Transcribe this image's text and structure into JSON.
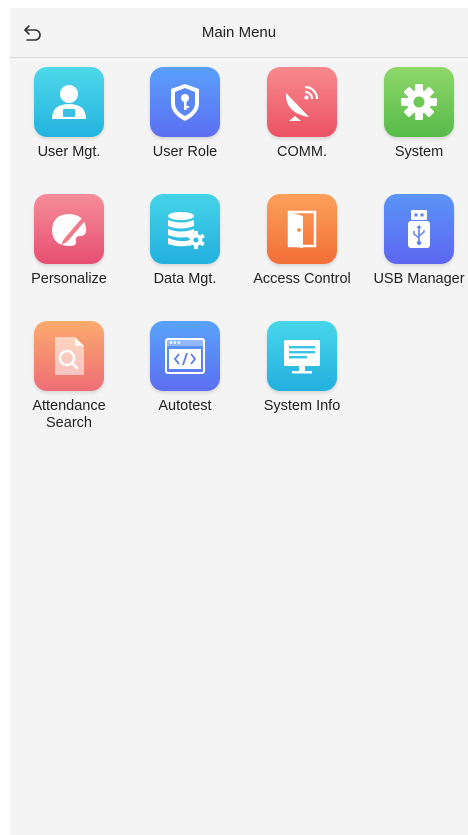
{
  "header": {
    "title": "Main Menu",
    "back_icon": "back-arrow-icon"
  },
  "menu": {
    "items": [
      {
        "label": "User Mgt.",
        "icon": "user-icon",
        "color": "#23b3e0"
      },
      {
        "label": "User Role",
        "icon": "shield-key-icon",
        "color": "#5c6ff2"
      },
      {
        "label": "COMM.",
        "icon": "satellite-dish-icon",
        "color": "#ec5264"
      },
      {
        "label": "System",
        "icon": "gear-icon",
        "color": "#57bb4a"
      },
      {
        "label": "Personalize",
        "icon": "palette-icon",
        "color": "#e64f72"
      },
      {
        "label": "Data Mgt.",
        "icon": "database-gear-icon",
        "color": "#22b0df"
      },
      {
        "label": "Access Control",
        "icon": "door-icon",
        "color": "#f26f38"
      },
      {
        "label": "USB Manager",
        "icon": "usb-icon",
        "color": "#5c66f0"
      },
      {
        "label": "Attendance\nSearch",
        "icon": "document-search-icon",
        "color": "#ee6e76"
      },
      {
        "label": "Autotest",
        "icon": "code-window-icon",
        "color": "#5c6ff2"
      },
      {
        "label": "System Info",
        "icon": "monitor-icon",
        "color": "#22b0df"
      }
    ]
  }
}
